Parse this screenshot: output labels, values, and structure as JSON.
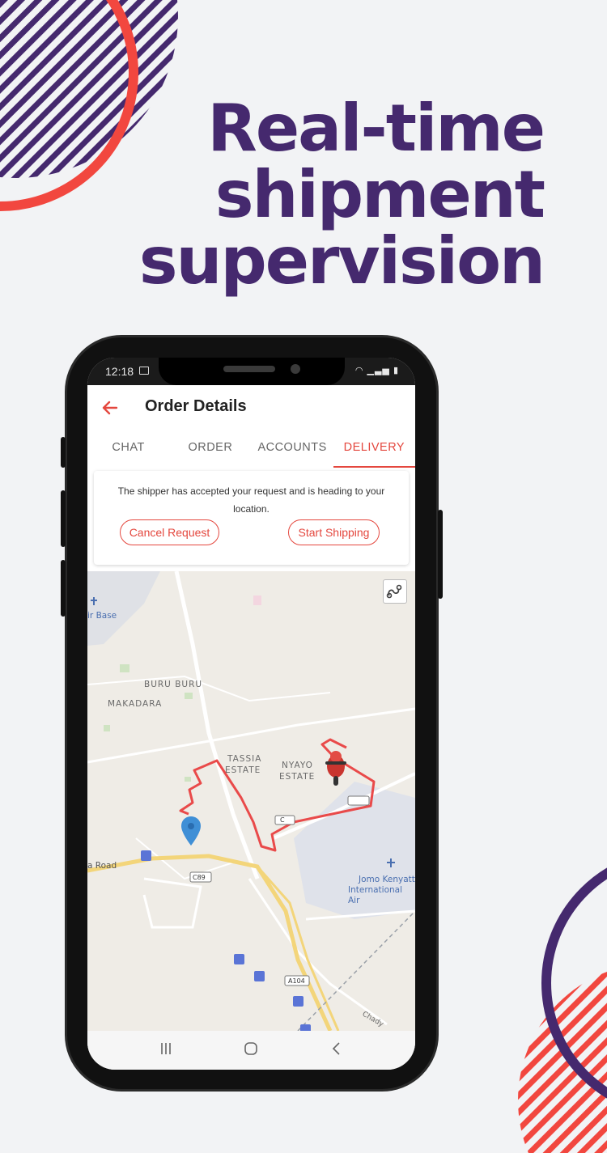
{
  "promo": {
    "line1": "Real-time",
    "line2": "shipment",
    "line3": "supervision",
    "colors": {
      "headline": "#45296e",
      "accent_red": "#f2473f",
      "purple": "#45296e",
      "background": "#f2f3f5"
    }
  },
  "status_bar": {
    "time": "12:18",
    "left_icons": [
      "image-icon"
    ],
    "right_icons": [
      "wifi-icon",
      "signal-icon",
      "signal-icon",
      "battery-icon"
    ]
  },
  "app_bar": {
    "back_icon": "arrow-left-icon",
    "title": "Order Details"
  },
  "tabs": [
    {
      "label": "CHAT",
      "active": false
    },
    {
      "label": "ORDER",
      "active": false
    },
    {
      "label": "ACCOUNTS",
      "active": false
    },
    {
      "label": "DELIVERY",
      "active": true
    }
  ],
  "delivery_card": {
    "message": "The shipper has accepted your request and is heading to your location.",
    "cancel_label": "Cancel Request",
    "start_label": "Start Shipping"
  },
  "map": {
    "labels": {
      "air_base": "ir Base",
      "buru_buru": "BURU BURU",
      "makadara": "MAKADARA",
      "tassia": "TASSIA",
      "estate1": "ESTATE",
      "nyayo": "NYAYO",
      "estate2": "ESTATE",
      "road": "a Road",
      "c89": "C89",
      "a104": "A104",
      "c_small": "C",
      "jomo_line1": "Jomo Kenyatt",
      "jomo_line2": "International Air",
      "chady": "Chady"
    },
    "route_color": "#e94a4a",
    "pin_color": "#3f8fd6",
    "layers_icon": "route-layers-icon"
  },
  "nav_bar": {
    "recents_icon": "recents-icon",
    "home_icon": "home-icon",
    "back_icon": "back-chevron-icon"
  }
}
